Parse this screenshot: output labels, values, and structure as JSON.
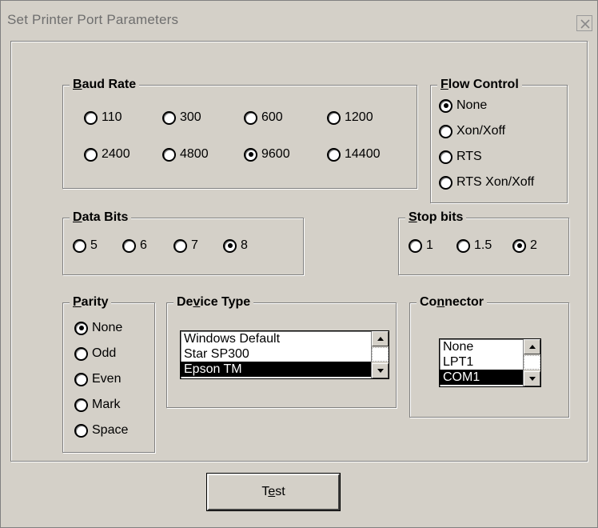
{
  "window": {
    "title": "Set Printer Port Parameters",
    "close_icon": "close-icon"
  },
  "baud_rate": {
    "title_mnemonic": "B",
    "title_rest": "aud Rate",
    "options": [
      "110",
      "300",
      "600",
      "1200",
      "2400",
      "4800",
      "9600",
      "14400"
    ],
    "selected": "9600"
  },
  "flow_control": {
    "title_mnemonic": "F",
    "title_rest": "low Control",
    "options": [
      "None",
      "Xon/Xoff",
      "RTS",
      "RTS Xon/Xoff"
    ],
    "selected": "None"
  },
  "data_bits": {
    "title_mnemonic": "D",
    "title_rest": "ata Bits",
    "options": [
      "5",
      "6",
      "7",
      "8"
    ],
    "selected": "8"
  },
  "stop_bits": {
    "title_mnemonic": "S",
    "title_rest": "top bits",
    "options": [
      "1",
      "1.5",
      "2"
    ],
    "selected": "2"
  },
  "parity": {
    "title_mnemonic": "P",
    "title_rest": "arity",
    "options": [
      "None",
      "Odd",
      "Even",
      "Mark",
      "Space"
    ],
    "selected": "None"
  },
  "device_type": {
    "title_before": "De",
    "title_mnemonic": "v",
    "title_after": "ice Type",
    "items": [
      "Windows Default",
      "Star SP300",
      "Epson TM"
    ],
    "selected": "Epson TM"
  },
  "connector": {
    "title_before": "Co",
    "title_mnemonic": "n",
    "title_after": "nector",
    "items": [
      "None",
      "LPT1",
      "COM1"
    ],
    "selected": "COM1"
  },
  "test_button": {
    "label_before": "T",
    "label_mnemonic": "e",
    "label_after": "st"
  }
}
